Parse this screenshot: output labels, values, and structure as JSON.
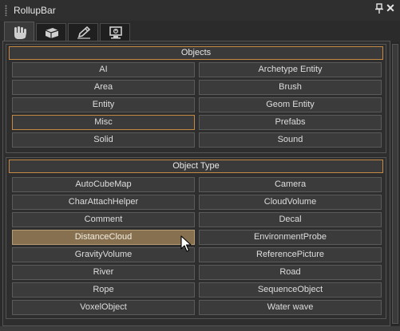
{
  "window": {
    "title": "RollupBar"
  },
  "tabs": [
    {
      "icon": "hand-icon",
      "active": true
    },
    {
      "icon": "cube-icon",
      "active": false
    },
    {
      "icon": "pencil-icon",
      "active": false
    },
    {
      "icon": "monitor-icon",
      "active": false
    }
  ],
  "objects_section": {
    "title": "Objects",
    "buttons": [
      "AI",
      "Archetype Entity",
      "Area",
      "Brush",
      "Entity",
      "Geom Entity",
      "Misc",
      "Prefabs",
      "Solid",
      "Sound"
    ],
    "selected": "Misc"
  },
  "object_type_section": {
    "title": "Object Type",
    "buttons": [
      "AutoCubeMap",
      "Camera",
      "CharAttachHelper",
      "CloudVolume",
      "Comment",
      "Decal",
      "DistanceCloud",
      "EnvironmentProbe",
      "GravityVolume",
      "ReferencePicture",
      "River",
      "Road",
      "Rope",
      "SequenceObject",
      "VoxelObject",
      "Water wave"
    ],
    "hovered": "DistanceCloud"
  },
  "colors": {
    "accent": "#c48a45",
    "hover_fill": "#86704f",
    "background": "#2b2b2b"
  }
}
